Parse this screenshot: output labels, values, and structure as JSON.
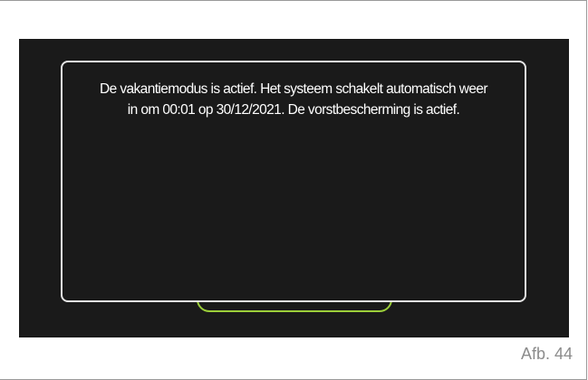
{
  "dialog": {
    "message_line1": "De vakantiemodus is actief. Het systeem schakelt automatisch weer",
    "message_line2": "in om 00:01 op 30/12/2021. De vorstbescherming is actief."
  },
  "figure": {
    "caption": "Afb. 44"
  },
  "colors": {
    "screen_background": "#1a1a1a",
    "dialog_border": "#e6e6e6",
    "accent_green": "#9ccf3a"
  }
}
